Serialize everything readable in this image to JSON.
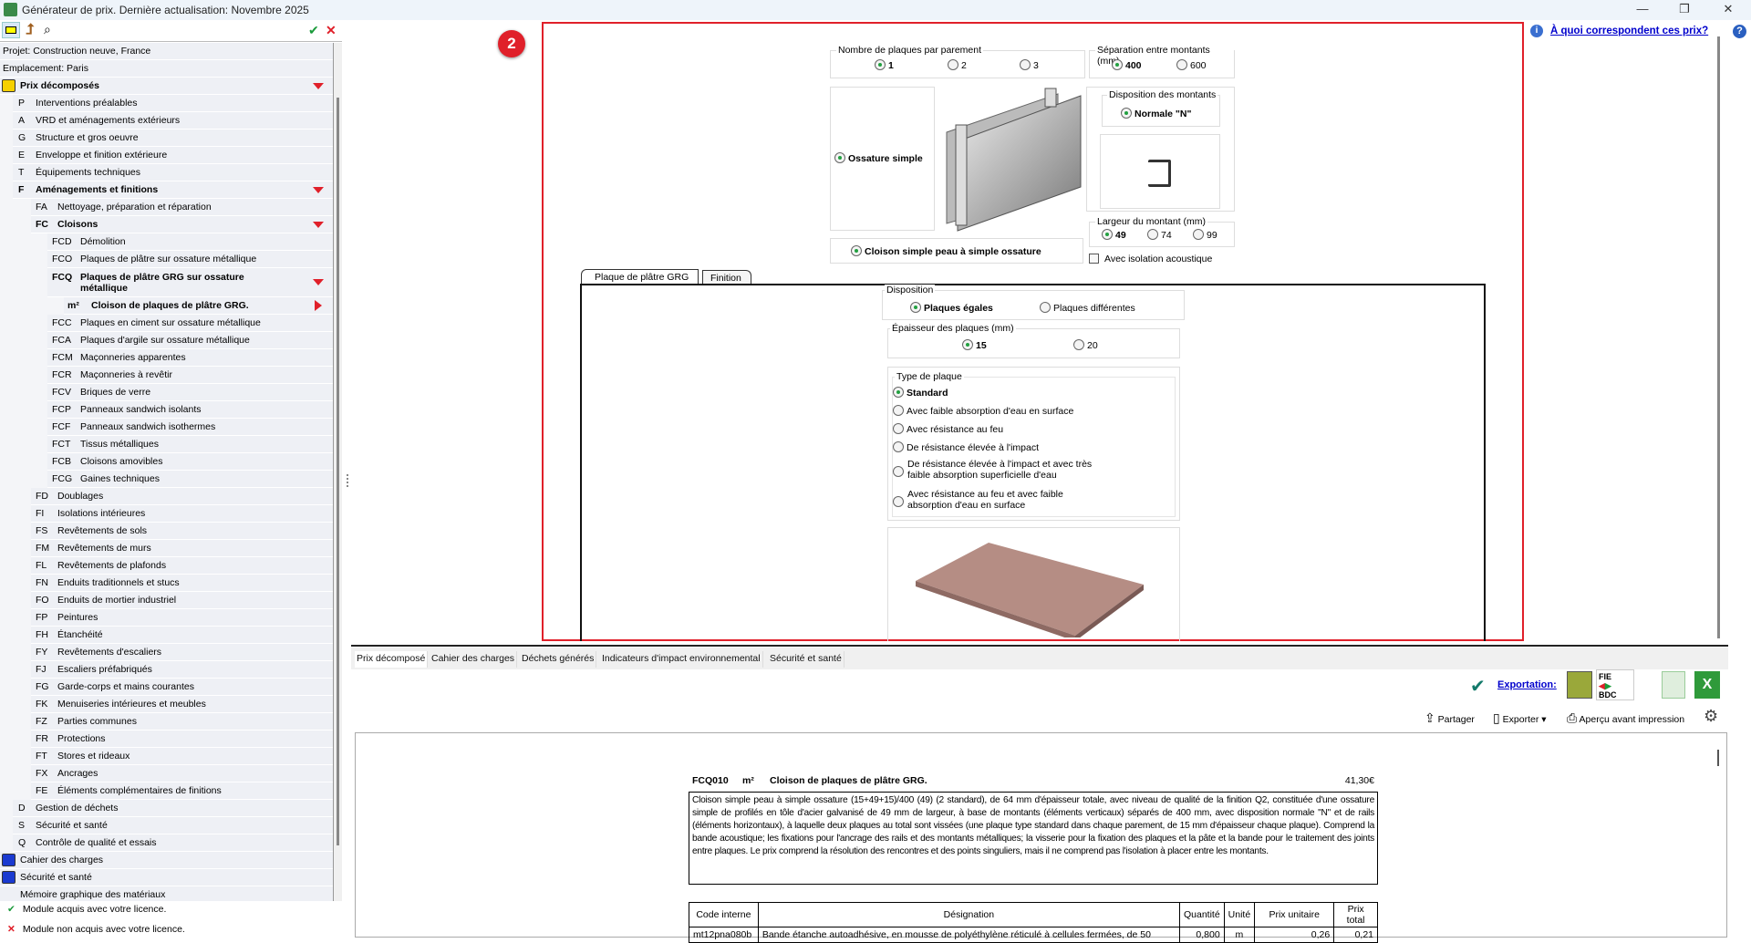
{
  "window": {
    "title": "Générateur de prix. Dernière actualisation: Novembre 2025",
    "minimize": "—",
    "maximize": "❐",
    "close": "✕"
  },
  "toolbar": {
    "ok": "✔",
    "cancel": "✕"
  },
  "sidebar": {
    "project": "Projet: Construction neuve, France",
    "location": "Emplacement: Paris",
    "tree": [
      {
        "code": "",
        "label": "Prix décomposés",
        "level": 0,
        "bold": true,
        "arrow": "down",
        "icon": "euro-tag-icon"
      },
      {
        "code": "P",
        "label": "Interventions préalables",
        "level": 1
      },
      {
        "code": "A",
        "label": "VRD et aménagements extérieurs",
        "level": 1
      },
      {
        "code": "G",
        "label": "Structure et gros oeuvre",
        "level": 1
      },
      {
        "code": "E",
        "label": "Enveloppe et finition extérieure",
        "level": 1
      },
      {
        "code": "T",
        "label": "Équipements techniques",
        "level": 1
      },
      {
        "code": "F",
        "label": "Aménagements et finitions",
        "level": 1,
        "bold": true,
        "arrow": "down"
      },
      {
        "code": "FA",
        "label": "Nettoyage, préparation et réparation",
        "level": 2
      },
      {
        "code": "FC",
        "label": "Cloisons",
        "level": 2,
        "bold": true,
        "arrow": "down"
      },
      {
        "code": "FCD",
        "label": "Démolition",
        "level": 3
      },
      {
        "code": "FCO",
        "label": "Plaques de plâtre sur ossature métallique",
        "level": 3
      },
      {
        "code": "FCQ",
        "label": "Plaques de plâtre GRG sur ossature métallique",
        "level": 3,
        "bold": true,
        "arrow": "down",
        "double": true
      },
      {
        "code": "m²",
        "label": "Cloison de plaques de plâtre GRG.",
        "level": 4,
        "bold": true,
        "arrow": "right"
      },
      {
        "code": "FCC",
        "label": "Plaques en ciment sur ossature métallique",
        "level": 3
      },
      {
        "code": "FCA",
        "label": "Plaques d'argile sur ossature métallique",
        "level": 3
      },
      {
        "code": "FCM",
        "label": "Maçonneries apparentes",
        "level": 3
      },
      {
        "code": "FCR",
        "label": "Maçonneries à revêtir",
        "level": 3
      },
      {
        "code": "FCV",
        "label": "Briques de verre",
        "level": 3
      },
      {
        "code": "FCP",
        "label": "Panneaux sandwich isolants",
        "level": 3
      },
      {
        "code": "FCF",
        "label": "Panneaux sandwich isothermes",
        "level": 3
      },
      {
        "code": "FCT",
        "label": "Tissus métalliques",
        "level": 3
      },
      {
        "code": "FCB",
        "label": "Cloisons amovibles",
        "level": 3
      },
      {
        "code": "FCG",
        "label": "Gaines techniques",
        "level": 3
      },
      {
        "code": "FD",
        "label": "Doublages",
        "level": 2
      },
      {
        "code": "FI",
        "label": "Isolations intérieures",
        "level": 2
      },
      {
        "code": "FS",
        "label": "Revêtements de sols",
        "level": 2
      },
      {
        "code": "FM",
        "label": "Revêtements de murs",
        "level": 2
      },
      {
        "code": "FL",
        "label": "Revêtements de plafonds",
        "level": 2
      },
      {
        "code": "FN",
        "label": "Enduits traditionnels et stucs",
        "level": 2
      },
      {
        "code": "FO",
        "label": "Enduits de mortier industriel",
        "level": 2
      },
      {
        "code": "FP",
        "label": "Peintures",
        "level": 2
      },
      {
        "code": "FH",
        "label": "Étanchéité",
        "level": 2
      },
      {
        "code": "FY",
        "label": "Revêtements d'escaliers",
        "level": 2
      },
      {
        "code": "FJ",
        "label": "Escaliers préfabriqués",
        "level": 2
      },
      {
        "code": "FG",
        "label": "Garde-corps et mains courantes",
        "level": 2
      },
      {
        "code": "FK",
        "label": "Menuiseries intérieures et meubles",
        "level": 2
      },
      {
        "code": "FZ",
        "label": "Parties communes",
        "level": 2
      },
      {
        "code": "FR",
        "label": "Protections",
        "level": 2
      },
      {
        "code": "FT",
        "label": "Stores et rideaux",
        "level": 2
      },
      {
        "code": "FX",
        "label": "Ancrages",
        "level": 2
      },
      {
        "code": "FE",
        "label": "Éléments complémentaires de finitions",
        "level": 2
      },
      {
        "code": "D",
        "label": "Gestion de déchets",
        "level": 1
      },
      {
        "code": "S",
        "label": "Sécurité et santé",
        "level": 1
      },
      {
        "code": "Q",
        "label": "Contrôle de qualité et essais",
        "level": 1
      },
      {
        "code": "",
        "label": "Cahier des charges",
        "level": 0,
        "icon": "scroll-icon"
      },
      {
        "code": "",
        "label": "Sécurité et santé",
        "level": 0,
        "icon": "helmet-icon"
      },
      {
        "code": "",
        "label": "Mémoire graphique des matériaux",
        "level": 0
      }
    ],
    "legend_ok": "Module acquis avec votre licence.",
    "legend_no": "Module non acquis avec votre licence."
  },
  "badge": "2",
  "help_link": "À quoi correspondent ces prix?",
  "options": {
    "nb_plaques": {
      "caption": "Nombre de plaques par parement",
      "options": [
        "1",
        "2",
        "3"
      ],
      "selected": 0
    },
    "separation": {
      "caption": "Séparation entre montants (mm)",
      "options": [
        "400",
        "600"
      ],
      "selected": 0
    },
    "ossature": "Ossature simple",
    "disposition_montants": {
      "caption": "Disposition des montants",
      "option": "Normale \"N\""
    },
    "largeur": {
      "caption": "Largeur du montant (mm)",
      "options": [
        "49",
        "74",
        "99"
      ],
      "selected": 0
    },
    "cloison": "Cloison simple peau à simple ossature",
    "isolation": "Avec isolation acoustique",
    "tabs": [
      "Plaque de plâtre GRG",
      "Finition"
    ],
    "disposition": {
      "caption": "Disposition",
      "options": [
        "Plaques égales",
        "Plaques différentes"
      ],
      "selected": 0
    },
    "epaisseur": {
      "caption": "Épaisseur des plaques (mm)",
      "options": [
        "15",
        "20"
      ],
      "selected": 0
    },
    "type": {
      "caption": "Type de plaque",
      "options": [
        "Standard",
        "Avec faible absorption d'eau en surface",
        "Avec résistance au feu",
        "De résistance élevée à l'impact",
        "De résistance élevée à l'impact et avec très faible absorption superficielle d'eau",
        "Avec résistance au feu et avec faible absorption d'eau en surface"
      ],
      "selected": 0
    }
  },
  "bottom": {
    "tabs": [
      "Prix décomposé",
      "Cahier des charges",
      "Déchets générés",
      "Indicateurs d'impact environnemental",
      "Sécurité et santé"
    ],
    "export_label": "Exportation:",
    "share": "Partager",
    "export": "Exporter",
    "preview": "Aperçu avant impression",
    "doc": {
      "code": "FCQ010",
      "unit": "m²",
      "title": "Cloison de plaques de plâtre GRG.",
      "price": "41,30€",
      "description": "Cloison simple peau à simple ossature (15+49+15)/400 (49) (2 standard), de 64 mm d'épaisseur totale, avec niveau de qualité de la finition Q2, constituée d'une ossature simple de profilés en tôle d'acier galvanisé de 49 mm de largeur, à base de montants (éléments verticaux) séparés de 400 mm, avec disposition normale \"N\" et de rails (éléments horizontaux), à laquelle deux plaques au total sont vissées (une plaque type standard dans chaque parement, de 15 mm d'épaisseur chaque plaque). Comprend la bande acoustique; les fixations pour l'ancrage des rails et des montants métalliques; la visserie pour la fixation des plaques et la pâte et la bande pour le traitement des joints entre plaques. Le prix comprend la résolution des rencontres et des points singuliers, mais il ne comprend pas l'isolation à placer entre les montants.",
      "headers": [
        "Code interne",
        "Désignation",
        "Quantité",
        "Unité",
        "Prix unitaire",
        "Prix total"
      ],
      "rows": [
        [
          "mt12pna080b",
          "Bande étanche autoadhésive, en mousse de polyéthylène réticulé à cellules fermées, de 50",
          "0,800",
          "m",
          "0,26",
          "0,21"
        ]
      ]
    }
  },
  "colors": {
    "accent_red": "#e0202a",
    "check_green": "#1a9a3a",
    "link": "#0000cc"
  }
}
